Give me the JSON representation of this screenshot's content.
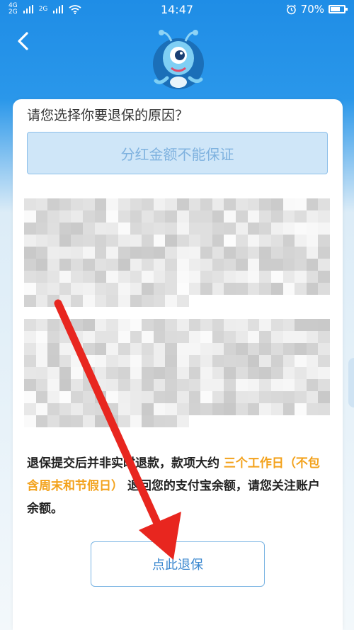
{
  "status_bar": {
    "signal_top": "4G",
    "signal_bottom": "2G",
    "signal2_top": "2G",
    "signal2_bottom": "",
    "time": "14:47",
    "battery": "70%",
    "battery_level": 0.7
  },
  "page": {
    "question": "请您选择你要退保的原因？",
    "selected_reason": "分红金额不能保证",
    "notice_part1": "退保提交后并非实时退款，款项大约 ",
    "notice_highlight": "三个工作日（不包含周末和节假日）",
    "notice_part2": " 退回您的支付宝余额，请您关注账户余额。",
    "refund_button": "点此退保"
  },
  "icons": {
    "back": "chevron-left-icon",
    "mascot": "ant-mascot-icon",
    "alarm": "alarm-icon",
    "wifi": "wifi-icon",
    "battery": "battery-icon"
  },
  "colors": {
    "header_blue": "#1f8de6",
    "highlight_orange": "#f3a21c",
    "button_blue": "#3a87cf",
    "arrow_red": "#e8261f"
  }
}
